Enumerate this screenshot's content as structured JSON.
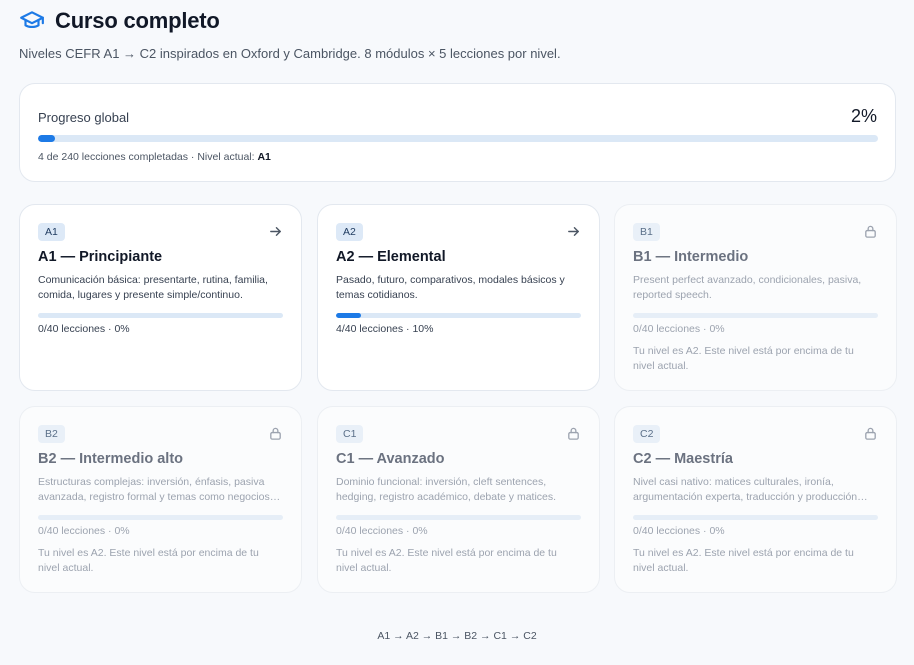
{
  "header": {
    "title": "Curso completo",
    "subtitle": "Niveles CEFR A1 → C2 inspirados en Oxford y Cambridge. 8 módulos × 5 lecciones por nivel.",
    "icon": "graduation-cap-icon"
  },
  "progress": {
    "label": "Progreso global",
    "percent_text": "2%",
    "fraction": 0.02,
    "summary_prefix": "4 de 240 lecciones completadas · Nivel actual: ",
    "current_level": "A1"
  },
  "levels": [
    {
      "code": "A1",
      "title": "A1 — Principiante",
      "description": "Comunicación básica: presentarte, rutina, familia, comida, lugares y presente simple/continuo.",
      "progress_text": "0/40 lecciones · 0%",
      "fraction": 0,
      "locked": false,
      "lock_note": "",
      "icon": "arrow-right-icon"
    },
    {
      "code": "A2",
      "title": "A2 — Elemental",
      "description": "Pasado, futuro, comparativos, modales básicos y temas cotidianos.",
      "progress_text": "4/40 lecciones · 10%",
      "fraction": 0.1,
      "locked": false,
      "lock_note": "",
      "icon": "arrow-right-icon"
    },
    {
      "code": "B1",
      "title": "B1 — Intermedio",
      "description": "Present perfect avanzado, condicionales, pasiva, reported speech.",
      "progress_text": "0/40 lecciones · 0%",
      "fraction": 0,
      "locked": true,
      "lock_note": "Tu nivel es A2. Este nivel está por encima de tu nivel actual.",
      "icon": "lock-icon"
    },
    {
      "code": "B2",
      "title": "B2 — Intermedio alto",
      "description": "Estructuras complejas: inversión, énfasis, pasiva avanzada, registro formal y temas como negocios…",
      "progress_text": "0/40 lecciones · 0%",
      "fraction": 0,
      "locked": true,
      "lock_note": "Tu nivel es A2. Este nivel está por encima de tu nivel actual.",
      "icon": "lock-icon"
    },
    {
      "code": "C1",
      "title": "C1 — Avanzado",
      "description": "Dominio funcional: inversión, cleft sentences, hedging, registro académico, debate y matices.",
      "progress_text": "0/40 lecciones · 0%",
      "fraction": 0,
      "locked": true,
      "lock_note": "Tu nivel es A2. Este nivel está por encima de tu nivel actual.",
      "icon": "lock-icon"
    },
    {
      "code": "C2",
      "title": "C2 — Maestría",
      "description": "Nivel casi nativo: matices culturales, ironía, argumentación experta, traducción y producción…",
      "progress_text": "0/40 lecciones · 0%",
      "fraction": 0,
      "locked": true,
      "lock_note": "Tu nivel es A2. Este nivel está por encima de tu nivel actual.",
      "icon": "lock-icon"
    }
  ],
  "footer": {
    "path": "A1 → A2 → B1 → B2 → C1 → C2"
  },
  "colors": {
    "accent": "#1d7ae6",
    "track": "#dbe8f6",
    "badge_bg": "#dde9f7"
  }
}
